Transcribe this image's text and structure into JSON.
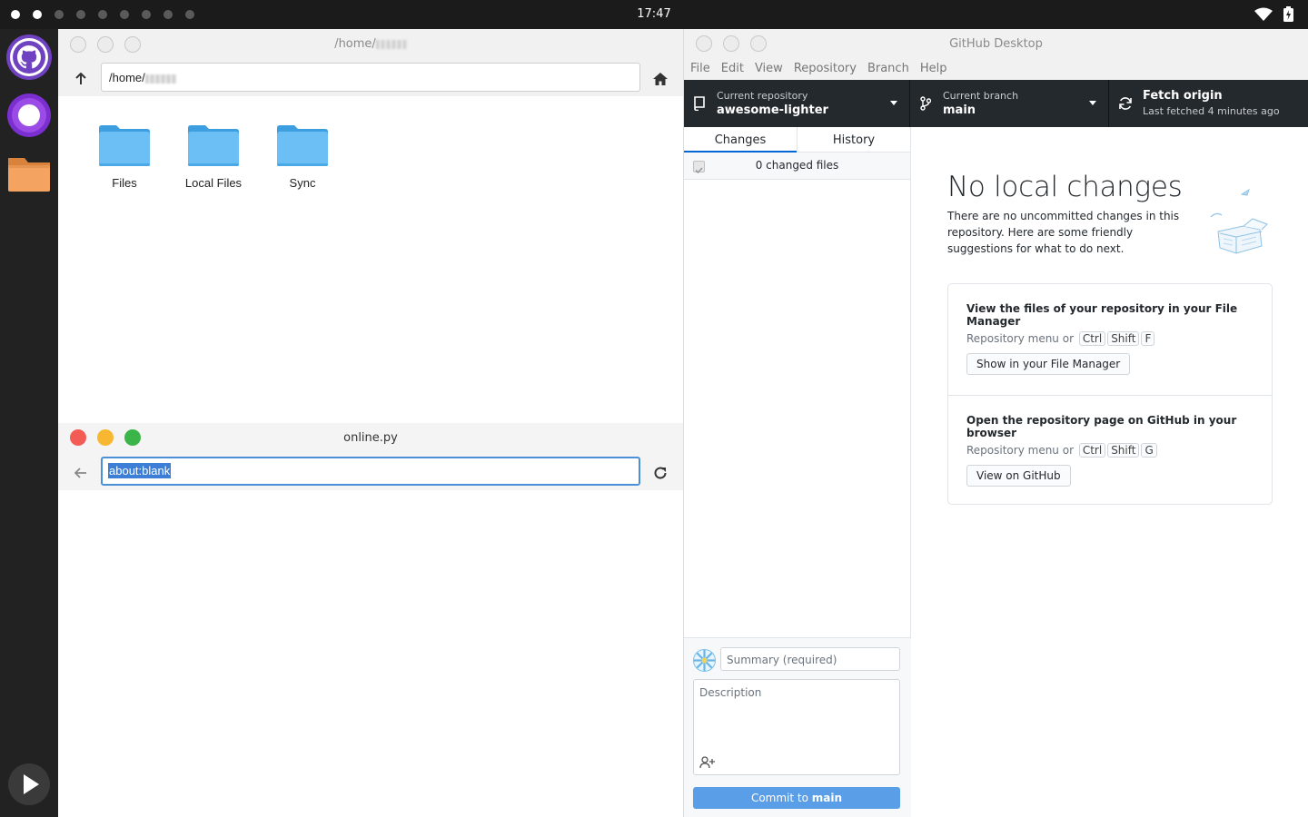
{
  "topbar": {
    "clock": "17:47",
    "workspaces": 9
  },
  "dock": {
    "items": [
      "github-desktop",
      "browser",
      "file-manager"
    ]
  },
  "file_manager": {
    "title": "/home/",
    "path": "/home/",
    "folders": [
      {
        "label": "Files"
      },
      {
        "label": "Local Files"
      },
      {
        "label": "Sync"
      }
    ]
  },
  "browser": {
    "title": "online.py",
    "url": "about:blank"
  },
  "github": {
    "title": "GitHub Desktop",
    "menu": [
      "File",
      "Edit",
      "View",
      "Repository",
      "Branch",
      "Help"
    ],
    "toolbar": {
      "repo_label": "Current repository",
      "repo_value": "awesome-lighter",
      "branch_label": "Current branch",
      "branch_value": "main",
      "fetch_title": "Fetch origin",
      "fetch_sub": "Last fetched 4 minutes ago"
    },
    "tabs": {
      "changes": "Changes",
      "history": "History"
    },
    "changes_count": "0 changed files",
    "commit": {
      "summary_placeholder": "Summary (required)",
      "description_placeholder": "Description",
      "button_prefix": "Commit to",
      "button_branch": "main"
    },
    "main": {
      "title": "No local changes",
      "text": "There are no uncommitted changes in this repository. Here are some friendly suggestions for what to do next.",
      "card1": {
        "title": "View the files of your repository in your File Manager",
        "sub": "Repository menu or",
        "keys": [
          "Ctrl",
          "Shift",
          "F"
        ],
        "button": "Show in your File Manager"
      },
      "card2": {
        "title": "Open the repository page on GitHub in your browser",
        "sub": "Repository menu or",
        "keys": [
          "Ctrl",
          "Shift",
          "G"
        ],
        "button": "View on GitHub"
      }
    }
  },
  "colors": {
    "accent": "#0366d6",
    "toolbar": "#24292e",
    "commit_button": "#5a9ee8"
  }
}
